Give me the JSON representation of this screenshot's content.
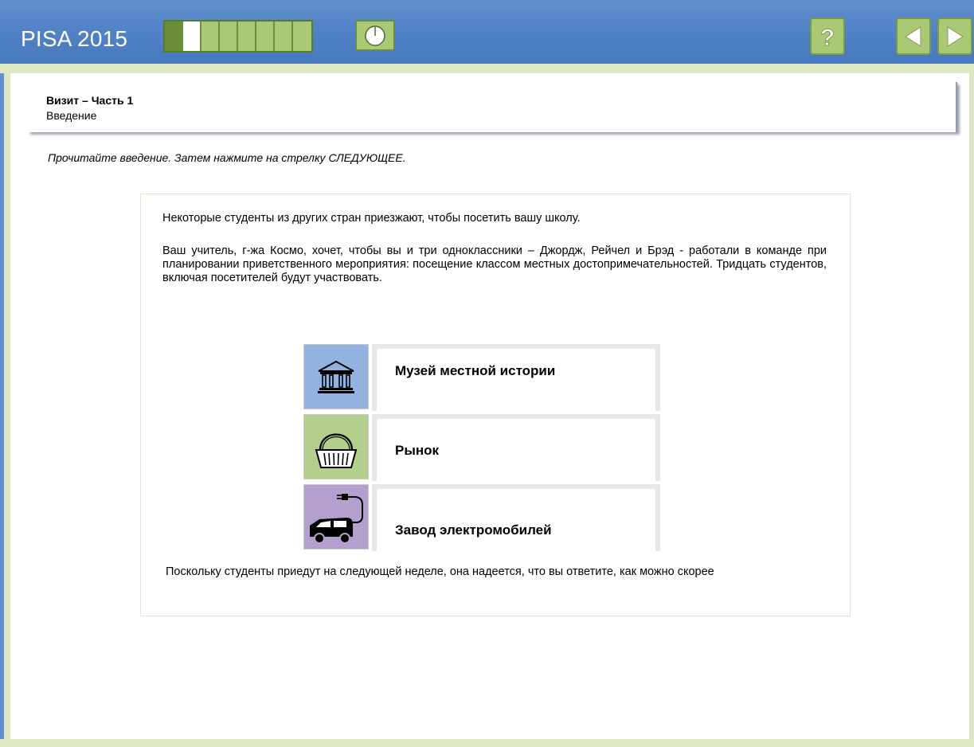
{
  "header": {
    "logo": "PISA 2015",
    "progress": {
      "total": 8,
      "completed": 1,
      "current_index": 1
    },
    "timer_icon": "clock-icon",
    "help_label": "?",
    "prev_icon": "arrow-left-icon",
    "next_icon": "arrow-right-icon",
    "colors": {
      "bar": "#4f80c4",
      "button": "#a9c976",
      "button_done": "#6b8c38"
    }
  },
  "unit": {
    "title": "Визит – Часть 1",
    "subtitle": "Введение"
  },
  "instruction": "Прочитайте введение. Затем нажмите на стрелку СЛЕДУЮЩЕЕ.",
  "stimulus": {
    "paragraph1": "Некоторые студенты из других стран приезжают, чтобы посетить вашу школу.",
    "paragraph2": "Ваш учитель, г-жа Космо, хочет, чтобы вы и три одноклассники – Джордж, Рейчел и Брэд - работали в команде при планировании приветственного мероприятия: посещение классом местных достопримечательностей. Тридцать студентов, включая посетителей будут участвовать.",
    "sites": [
      {
        "label": "Музей местной истории",
        "icon": "museum-icon",
        "color": "#92b3e0"
      },
      {
        "label": "Рынок",
        "icon": "basket-icon",
        "color": "#b4cf8d"
      },
      {
        "label": "Завод электромобилей",
        "icon": "electric-car-icon",
        "color": "#b3a0cf"
      }
    ],
    "paragraph3": "Поскольку студенты приедут на следующей неделе, она надеется, что вы ответите, как можно скорее"
  }
}
